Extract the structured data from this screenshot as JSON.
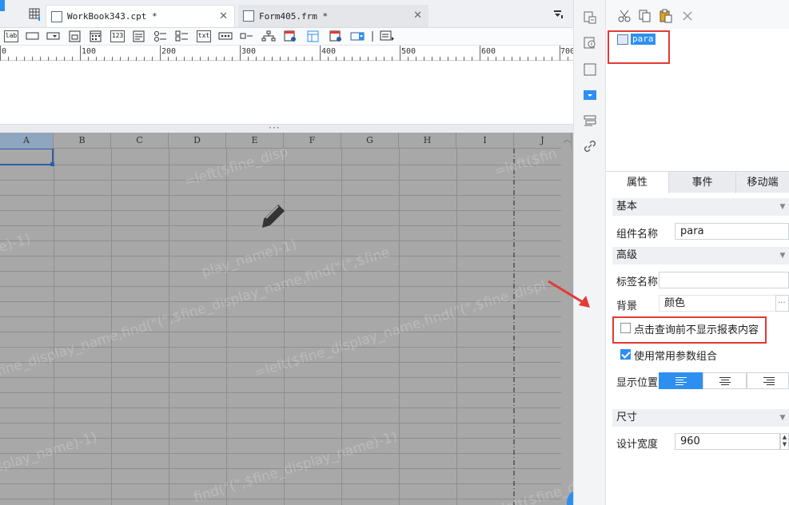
{
  "tabs": [
    {
      "label": "WorkBook343.cpt *",
      "active": true
    },
    {
      "label": "Form405.frm *",
      "active": false
    }
  ],
  "toolbar": {
    "label_widget_text": "lab",
    "number_widget_text": "123",
    "text_widget_text": "txt"
  },
  "ruler": {
    "ticks": [
      "0",
      "100",
      "200",
      "300",
      "400",
      "500",
      "600",
      "700"
    ]
  },
  "sheet": {
    "columns": [
      "A",
      "B",
      "C",
      "D",
      "E",
      "F",
      "G",
      "H",
      "I",
      "J"
    ],
    "watermark_texts": [
      "=left($fine_disp",
      "=left($fin",
      "e)-1)",
      "play_name)-1)",
      "fine_display_name,find(\"(\",$fine_display_name,find(\"(\",$fine",
      "=left($fine_display_name,find(\"(\",$fine_displ",
      "splay_name)-1)",
      "find(\"(\",$fine_display_name)-1)",
      "=left($fine_display_name,find(\"(\""
    ]
  },
  "help_button_label": "?",
  "tree": {
    "node_label": "para"
  },
  "prop_tabs": [
    "属性",
    "事件",
    "移动端"
  ],
  "properties": {
    "basic_section": "基本",
    "widget_name_label": "组件名称",
    "widget_name_value": "para",
    "advanced_section": "高级",
    "tag_name_label": "标签名称",
    "tag_name_value": "",
    "background_label": "背景",
    "background_value": "颜色",
    "background_more": "···",
    "hide_before_query_label": "点击查询前不显示报表内容",
    "hide_before_query_checked": false,
    "use_common_params_label": "使用常用参数组合",
    "use_common_params_checked": true,
    "display_position_label": "显示位置",
    "display_position_selected": "left",
    "size_section": "尺寸",
    "design_width_label": "设计宽度",
    "design_width_value": "960"
  },
  "colors": {
    "accent": "#2d8ff0",
    "annotation": "#e53935",
    "sheet_bg": "#a8a8a8"
  }
}
